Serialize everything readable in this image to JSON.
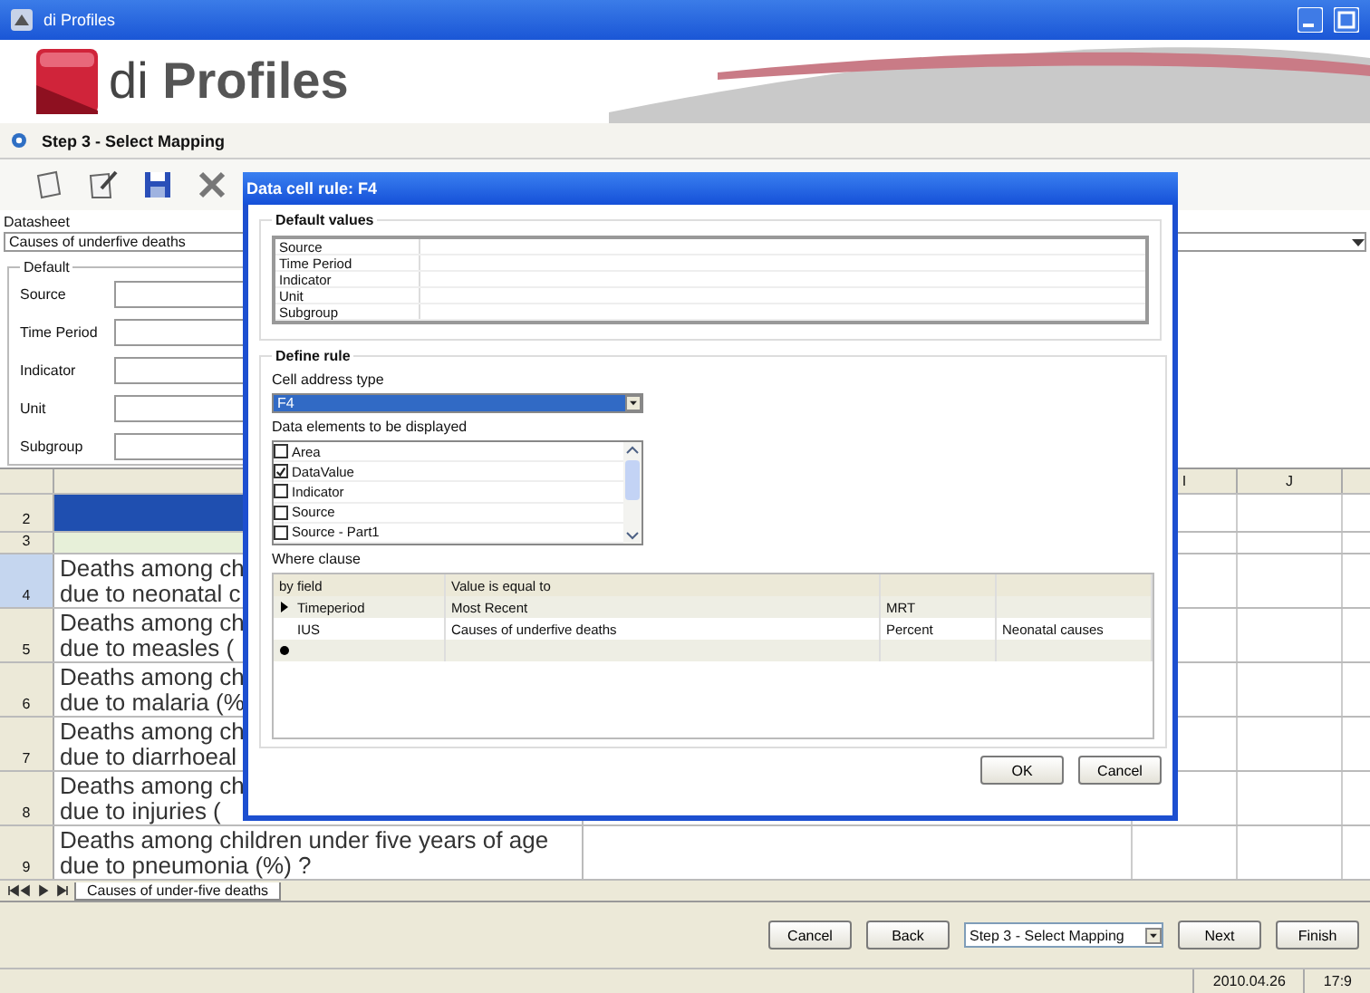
{
  "window": {
    "title": "di Profiles"
  },
  "banner": {
    "brand": "di **Profiles**"
  },
  "step": {
    "title": "Step 3 - Select Mapping"
  },
  "datasheet": {
    "label": "Datasheet",
    "value": "Causes of underfive deaths"
  },
  "defaults": {
    "title": "Default",
    "fields": [
      "Source",
      "Time Period",
      "Indicator",
      "Unit",
      "Subgroup"
    ]
  },
  "grid": {
    "columns": [
      "I",
      "J"
    ],
    "rows": [
      {
        "number": "2",
        "kind": "header",
        "lines": []
      },
      {
        "number": "3",
        "kind": "band",
        "lines": []
      },
      {
        "number": "4",
        "kind": "text",
        "selected": true,
        "lines": [
          "Deaths among ch",
          "due to neonatal c"
        ]
      },
      {
        "number": "5",
        "kind": "text",
        "selected": false,
        "lines": [
          "Deaths among ch",
          "due to measles ("
        ]
      },
      {
        "number": "6",
        "kind": "text",
        "selected": false,
        "lines": [
          "Deaths among ch",
          "due to malaria (%"
        ]
      },
      {
        "number": "7",
        "kind": "text",
        "selected": false,
        "lines": [
          "Deaths among ch",
          "due to diarrhoeal"
        ]
      },
      {
        "number": "8",
        "kind": "text",
        "selected": false,
        "lines": [
          "Deaths among ch",
          "due to injuries ("
        ]
      },
      {
        "number": "9",
        "kind": "text",
        "selected": false,
        "lines": [
          "Deaths among children under five years of age",
          "due to pneumonia (%) ?"
        ]
      }
    ],
    "sheet_tab": "Causes of under-five deaths"
  },
  "dialog": {
    "title": "Data cell rule: F4",
    "default_values": {
      "title": "Default values",
      "rows": [
        "Source",
        "Time Period",
        "Indicator",
        "Unit",
        "Subgroup"
      ]
    },
    "define_rule": {
      "title": "Define rule",
      "address_label": "Cell address type",
      "address_value": "F4",
      "elements_label": "Data elements to be displayed",
      "elements": [
        {
          "label": "Area",
          "checked": false
        },
        {
          "label": "DataValue",
          "checked": true
        },
        {
          "label": "Indicator",
          "checked": false
        },
        {
          "label": "Source",
          "checked": false
        },
        {
          "label": "Source - Part1",
          "checked": false
        }
      ],
      "where_label": "Where clause",
      "where_columns": [
        "by field",
        "Value is equal to"
      ],
      "where_rows": [
        {
          "kind": "current",
          "cells": [
            "Timeperiod",
            "Most Recent",
            "MRT",
            ""
          ]
        },
        {
          "kind": "plain",
          "cells": [
            "IUS",
            "Causes of underfive deaths",
            "Percent",
            "Neonatal causes"
          ]
        },
        {
          "kind": "new",
          "cells": []
        }
      ]
    },
    "buttons": [
      "OK",
      "Cancel"
    ]
  },
  "footer": {
    "buttons": [
      "Cancel",
      "Back"
    ],
    "step_select": "Step 3 - Select Mapping",
    "nav_buttons": [
      "Next",
      "Finish"
    ]
  },
  "status_bar": [
    "2010.04.26",
    "17:9"
  ]
}
